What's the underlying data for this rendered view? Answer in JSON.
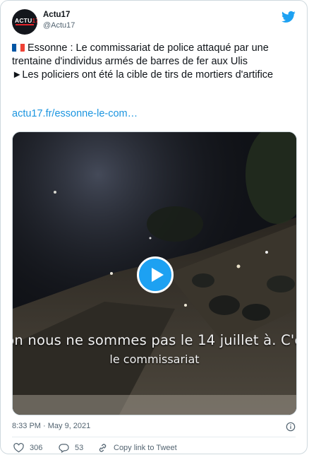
{
  "account": {
    "display_name": "Actu17",
    "handle": "@Actu17",
    "avatar_logo": "ACTU",
    "avatar_logo_accent": "17"
  },
  "tweet": {
    "line1": "Esonne : Le commissariat de police attaqué par une",
    "line1_full": "Essonne : Le commissariat de police attaqué par une trentaine d'individus armés de barres de fer aux Ulis",
    "line2": "►Les policiers ont été la cible de tirs de mortiers d'artifice",
    "link_text": "actu17.fr/essonne-le-com…"
  },
  "media": {
    "subtitle_line1": "on nous ne sommes pas le 14 juillet à. C'e",
    "subtitle_line2": "le commissariat",
    "play_icon": "play-icon"
  },
  "meta": {
    "timestamp": "8:33 PM · May 9, 2021"
  },
  "actions": {
    "likes": "306",
    "replies": "53",
    "copy_link": "Copy link to Tweet"
  },
  "colors": {
    "brand_blue": "#1da1f2",
    "link_blue": "#1b95e0",
    "muted": "#536471"
  }
}
